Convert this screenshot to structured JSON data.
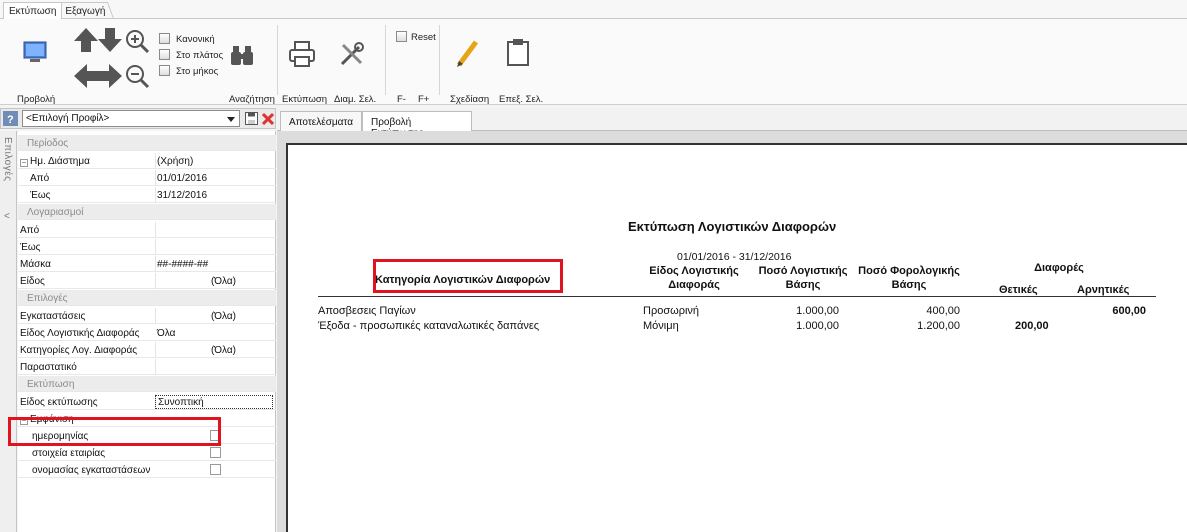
{
  "ribbon_tabs": [
    "Εκτύπωση",
    "Εξαγωγή"
  ],
  "ribbon": {
    "view_label": "Προβολή",
    "zoom_normal": "Κανονική",
    "zoom_width": "Στο πλάτος",
    "zoom_length": "Στο μήκος",
    "search_label": "Αναζήτηση",
    "print_label": "Εκτύπωση",
    "page_setup_label": "Διαμ. Σελ.",
    "reset_label": "Reset",
    "font_minus": "F-",
    "font_plus": "F+",
    "design_label": "Σχεδίαση",
    "select_page_label": "Επεξ. Σελ."
  },
  "profile": {
    "selected": "<Επιλογή Προφίλ>"
  },
  "side_tab": {
    "label": "Επιλογές",
    "collapse": "<"
  },
  "properties": [
    {
      "type": "cat",
      "label": "Περίοδος"
    },
    {
      "type": "row",
      "label": "Ημ. Διάστημα",
      "value": "(Χρήση)",
      "expand": "⊟"
    },
    {
      "type": "row",
      "label": "Από",
      "value": "01/01/2016",
      "indent": true
    },
    {
      "type": "row",
      "label": "Έως",
      "value": "31/12/2016",
      "indent": true
    },
    {
      "type": "cat",
      "label": "Λογαριασμοί"
    },
    {
      "type": "row",
      "label": "Από",
      "value": ""
    },
    {
      "type": "row",
      "label": "Έως",
      "value": ""
    },
    {
      "type": "row",
      "label": "Μάσκα",
      "value": "##-####-##"
    },
    {
      "type": "row",
      "label": "Είδος",
      "value": "(Όλα)",
      "right": true
    },
    {
      "type": "cat",
      "label": "Επιλογές"
    },
    {
      "type": "row",
      "label": "Εγκαταστάσεις",
      "value": "(Όλα)",
      "right": true
    },
    {
      "type": "row",
      "label": "Είδος Λογιστικής Διαφοράς",
      "value": "Όλα",
      "nodiv": true
    },
    {
      "type": "row",
      "label": "Κατηγορίες Λογ. Διαφοράς",
      "value": "(Όλα)",
      "right": true
    },
    {
      "type": "row",
      "label": "Παραστατικό",
      "value": ""
    },
    {
      "type": "cat",
      "label": "Εκτύπωση"
    },
    {
      "type": "row",
      "label": "Είδος εκτύπωσης",
      "value": "Συνοπτική",
      "selected": true
    },
    {
      "type": "row",
      "label": "Εμφάνιση",
      "value": "",
      "expand": "⊟",
      "nodiv": true
    },
    {
      "type": "chk",
      "label": "ημερομηνίας"
    },
    {
      "type": "chk",
      "label": "στοιχεία εταιρίας"
    },
    {
      "type": "chk",
      "label": "ονομασίας εγκαταστάσεων"
    }
  ],
  "doc_tabs": [
    "Αποτελέσματα",
    "Προβολή Εκτύπωσης"
  ],
  "report": {
    "title": "Εκτύπωση Λογιστικών Διαφορών",
    "period": "01/01/2016 - 31/12/2016",
    "headers": {
      "category": "Κατηγορία Λογιστικών Διαφορών",
      "type_l1": "Είδος Λογιστικής",
      "type_l2": "Διαφοράς",
      "acc_l1": "Ποσό Λογιστικής",
      "acc_l2": "Βάσης",
      "tax_l1": "Ποσό Φορολογικής",
      "tax_l2": "Βάσης",
      "diff": "Διαφορές",
      "pos": "Θετικές",
      "neg": "Αρνητικές"
    },
    "rows": [
      {
        "category": "Αποσβεσεις Παγίων",
        "type": "Προσωρινή",
        "acc": "1.000,00",
        "tax": "400,00",
        "pos": "",
        "neg": "600,00"
      },
      {
        "category": "Έξοδα - προσωπικές καταναλωτικές δαπάνες",
        "type": "Μόνιμη",
        "acc": "1.000,00",
        "tax": "1.200,00",
        "pos": "200,00",
        "neg": ""
      }
    ]
  },
  "colors": {
    "highlight_box": "#e0141e"
  }
}
